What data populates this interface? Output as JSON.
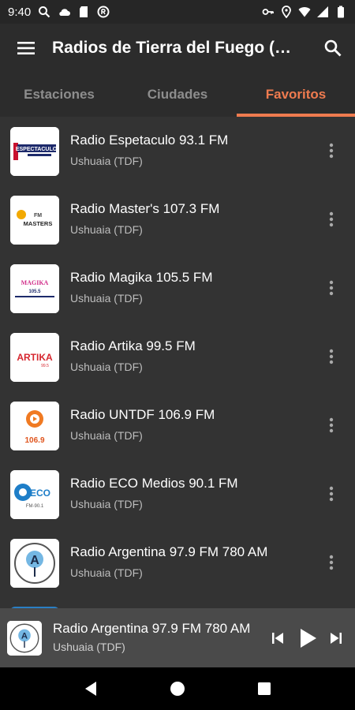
{
  "status_bar": {
    "time": "9:40",
    "icons_left": [
      "search-icon",
      "cloud-icon",
      "sd-card-icon",
      "radio-app-icon"
    ],
    "icons_right": [
      "key-icon",
      "location-icon",
      "wifi-icon",
      "signal-icon",
      "battery-icon"
    ]
  },
  "app_bar": {
    "title": "Radios de Tierra del Fuego (Argentina)",
    "menu_icon": "menu-icon",
    "search_icon": "search-icon"
  },
  "tabs": [
    {
      "label": "Estaciones",
      "active": false
    },
    {
      "label": "Ciudades",
      "active": false
    },
    {
      "label": "Favoritos",
      "active": true
    }
  ],
  "stations": [
    {
      "title": "Radio Espetaculo 93.1 FM",
      "city": "Ushuaia (TDF)",
      "logo_text": "ESPECTACULO"
    },
    {
      "title": "Radio Master's 107.3 FM",
      "city": "Ushuaia (TDF)",
      "logo_text": "MASTERS"
    },
    {
      "title": "Radio Magika 105.5 FM",
      "city": "Ushuaia (TDF)",
      "logo_text": "MAGIKA"
    },
    {
      "title": "Radio Artika 99.5 FM",
      "city": "Ushuaia (TDF)",
      "logo_text": "ARTIKA"
    },
    {
      "title": "Radio UNTDF 106.9 FM",
      "city": "Ushuaia (TDF)",
      "logo_text": "106.9"
    },
    {
      "title": "Radio ECO Medios 90.1 FM",
      "city": "Ushuaia (TDF)",
      "logo_text": "ECO"
    },
    {
      "title": "Radio Argentina 97.9 FM 780 AM",
      "city": "Ushuaia (TDF)",
      "logo_text": "A"
    }
  ],
  "mini_player": {
    "title": "Radio Argentina 97.9 FM 780 AM",
    "city": "Ushuaia (TDF)",
    "controls": [
      "skip-previous-icon",
      "play-icon",
      "skip-next-icon"
    ]
  },
  "colors": {
    "accent": "#ef7b4f",
    "background": "#333333",
    "app_bar": "#2c2c2c",
    "player": "#4a4a4a"
  }
}
